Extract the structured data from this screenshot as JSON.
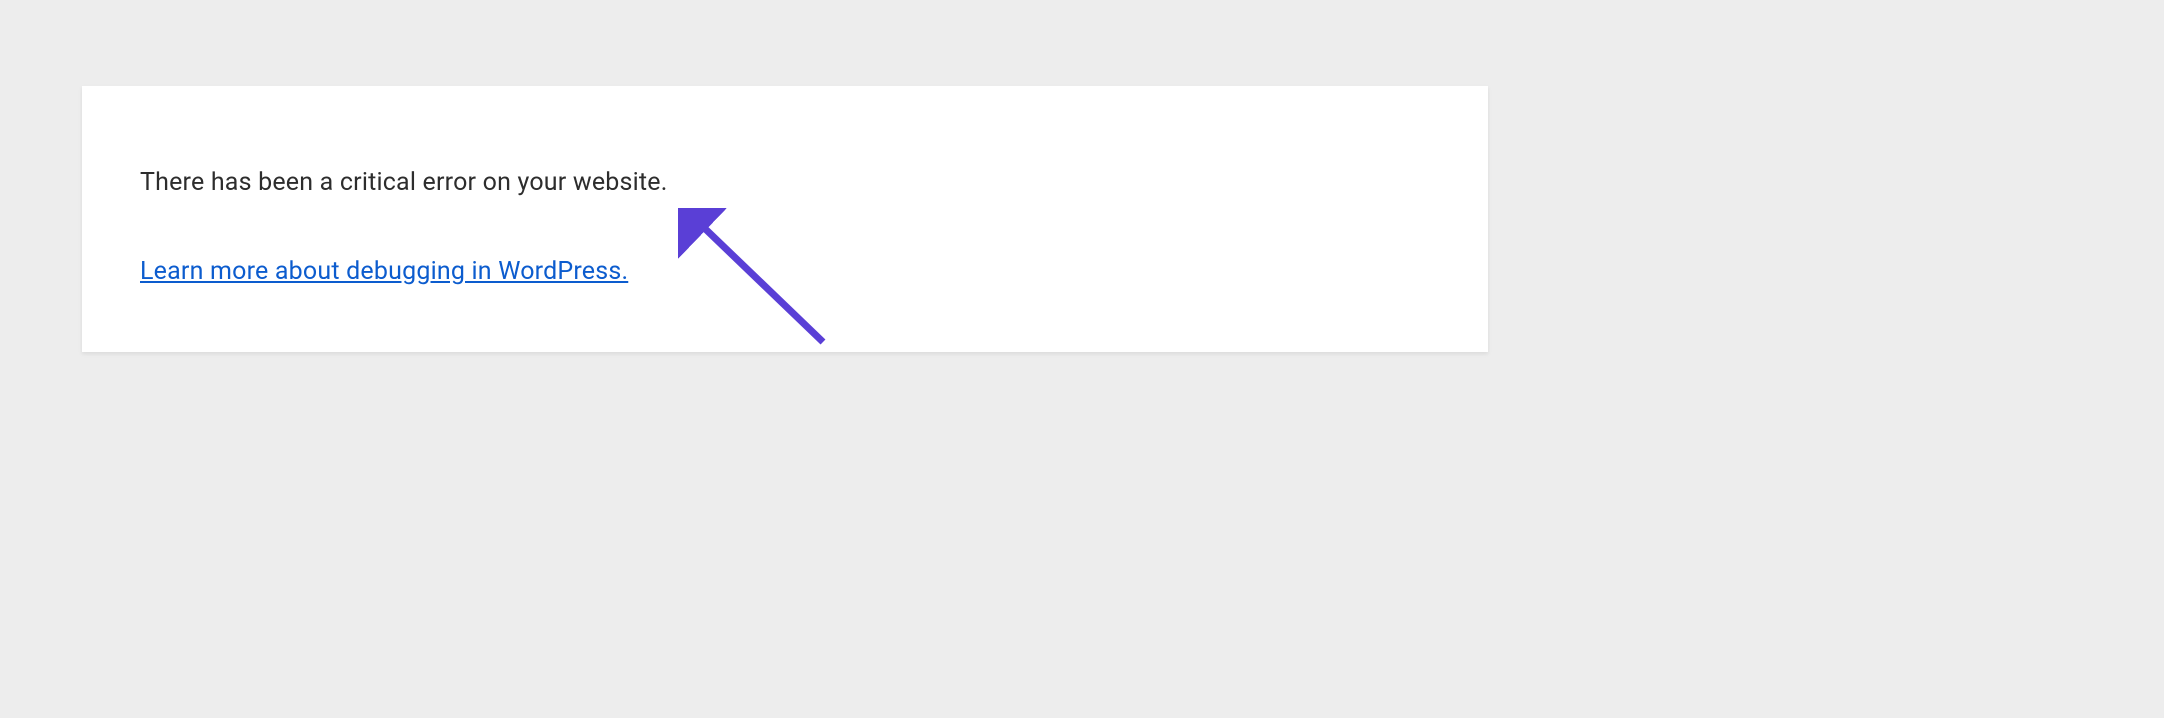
{
  "error": {
    "message": "There has been a critical error on your website.",
    "link_text": "Learn more about debugging in WordPress."
  }
}
